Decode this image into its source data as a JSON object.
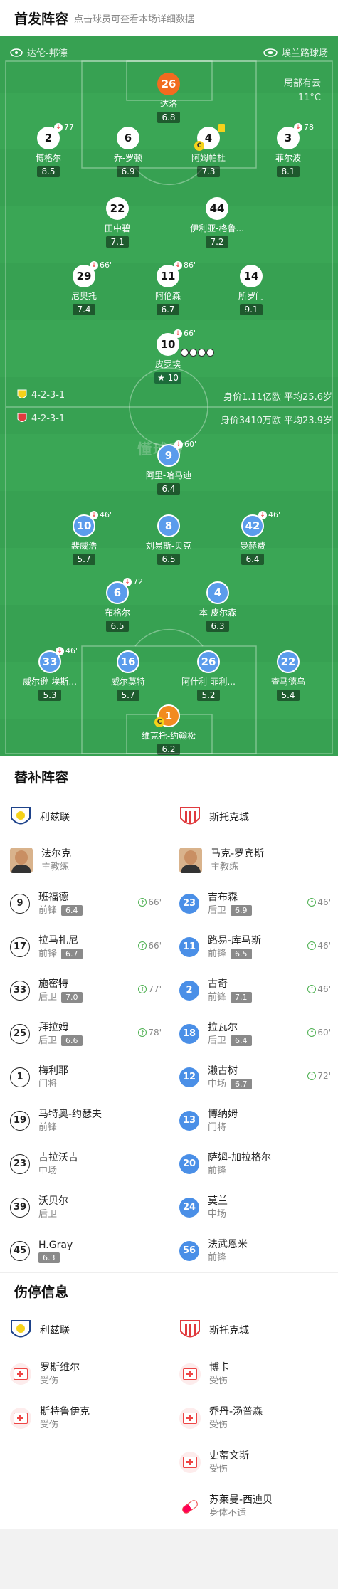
{
  "lineup_header": {
    "title": "首发阵容",
    "hint": "点击球员可查看本场详细数据"
  },
  "pitch": {
    "home_stadium": "达伦-邦德",
    "away_stadium": "埃兰路球场",
    "weather": {
      "condition": "局部有云",
      "temp": "11°C"
    },
    "watermark": "懂球帝",
    "home_formation": "4-2-3-1",
    "home_value": "身价1.11亿欧  平均25.6岁",
    "away_formation": "4-2-3-1",
    "away_value": "身价3410万欧  平均23.9岁",
    "home_players": [
      {
        "num": "26",
        "name": "达洛",
        "rating": "6.8",
        "star": true
      },
      {
        "num": "2",
        "name": "博格尔",
        "rating": "8.5",
        "sub": "77'"
      },
      {
        "num": "6",
        "name": "乔-罗顿",
        "rating": "6.9"
      },
      {
        "num": "4",
        "name": "阿姆帕杜",
        "rating": "7.3",
        "captain": "C",
        "card": true
      },
      {
        "num": "3",
        "name": "菲尔波",
        "rating": "8.1",
        "sub": "78'"
      },
      {
        "num": "22",
        "name": "田中碧",
        "rating": "7.1"
      },
      {
        "num": "44",
        "name": "伊利亚-格鲁...",
        "rating": "7.2"
      },
      {
        "num": "29",
        "name": "尼奥托",
        "rating": "7.4",
        "sub": "66'"
      },
      {
        "num": "11",
        "name": "阿伦森",
        "rating": "6.7",
        "sub": "86'"
      },
      {
        "num": "14",
        "name": "所罗门",
        "rating": "9.1"
      },
      {
        "num": "10",
        "name": "皮罗埃",
        "rating": "10",
        "sub": "66'",
        "mvp": true
      }
    ],
    "away_players": [
      {
        "num": "9",
        "name": "阿里-哈马迪",
        "rating": "6.4",
        "sub": "60'"
      },
      {
        "num": "10",
        "name": "裴威浩",
        "rating": "5.7",
        "sub": "46'"
      },
      {
        "num": "8",
        "name": "刘易斯-贝克",
        "rating": "6.5"
      },
      {
        "num": "42",
        "name": "曼赫费",
        "rating": "6.4",
        "sub": "46'"
      },
      {
        "num": "6",
        "name": "布格尔",
        "rating": "6.5",
        "sub": "72'"
      },
      {
        "num": "4",
        "name": "本-皮尔森",
        "rating": "6.3"
      },
      {
        "num": "33",
        "name": "威尔逊-埃斯...",
        "rating": "5.3",
        "sub": "46'"
      },
      {
        "num": "16",
        "name": "威尔莫特",
        "rating": "5.7"
      },
      {
        "num": "26",
        "name": "阿什利-菲利...",
        "rating": "5.2"
      },
      {
        "num": "22",
        "name": "查马德乌",
        "rating": "5.4"
      },
      {
        "num": "1",
        "name": "维克托-约翰松",
        "rating": "6.2",
        "captain": "C"
      }
    ]
  },
  "subs_header": {
    "title": "替补阵容"
  },
  "subs": {
    "home_team": "利兹联",
    "away_team": "斯托克城",
    "home_coach": {
      "name": "法尔克",
      "role": "主教练"
    },
    "away_coach": {
      "name": "马克-罗宾斯",
      "role": "主教练"
    },
    "home": [
      {
        "num": "9",
        "name": "班福德",
        "pos": "前锋",
        "rating": "6.4",
        "time": "66'"
      },
      {
        "num": "17",
        "name": "拉马扎尼",
        "pos": "前锋",
        "rating": "6.7",
        "time": "66'"
      },
      {
        "num": "33",
        "name": "施密特",
        "pos": "后卫",
        "rating": "7.0",
        "time": "77'"
      },
      {
        "num": "25",
        "name": "拜拉姆",
        "pos": "后卫",
        "rating": "6.6",
        "time": "78'"
      },
      {
        "num": "1",
        "name": "梅利耶",
        "pos": "门将"
      },
      {
        "num": "19",
        "name": "马特奥-约瑟夫",
        "pos": "前锋"
      },
      {
        "num": "23",
        "name": "吉拉沃吉",
        "pos": "中场"
      },
      {
        "num": "39",
        "name": "沃贝尔",
        "pos": "后卫"
      },
      {
        "num": "45",
        "name": "H.Gray",
        "pos": "",
        "rating": "6.3"
      }
    ],
    "away": [
      {
        "num": "23",
        "name": "吉布森",
        "pos": "后卫",
        "rating": "6.9",
        "time": "46'"
      },
      {
        "num": "11",
        "name": "路易-库马斯",
        "pos": "前锋",
        "rating": "6.5",
        "time": "46'"
      },
      {
        "num": "2",
        "name": "古奇",
        "pos": "前锋",
        "rating": "7.1",
        "time": "46'"
      },
      {
        "num": "18",
        "name": "拉瓦尔",
        "pos": "后卫",
        "rating": "6.4",
        "time": "60'"
      },
      {
        "num": "12",
        "name": "濑古树",
        "pos": "中场",
        "rating": "6.7",
        "time": "72'"
      },
      {
        "num": "13",
        "name": "博纳姆",
        "pos": "门将"
      },
      {
        "num": "20",
        "name": "萨姆-加拉格尔",
        "pos": "前锋"
      },
      {
        "num": "24",
        "name": "莫兰",
        "pos": "中场"
      },
      {
        "num": "56",
        "name": "法武恩米",
        "pos": "前锋"
      }
    ]
  },
  "injury_header": {
    "title": "伤停信息"
  },
  "injuries": {
    "home": [
      {
        "name": "罗斯维尔",
        "status": "受伤"
      },
      {
        "name": "斯特鲁伊克",
        "status": "受伤"
      }
    ],
    "away": [
      {
        "name": "博卡",
        "status": "受伤"
      },
      {
        "name": "乔丹-汤普森",
        "status": "受伤"
      },
      {
        "name": "史蒂文斯",
        "status": "受伤"
      },
      {
        "name": "苏莱曼-西迪贝",
        "status": "身体不适",
        "icon": "pill"
      }
    ]
  },
  "colors": {
    "pitch": "#3aa655",
    "home_circle": "#ffffff",
    "away_circle": "#5b9cec",
    "mvp": "#f26b1f"
  }
}
